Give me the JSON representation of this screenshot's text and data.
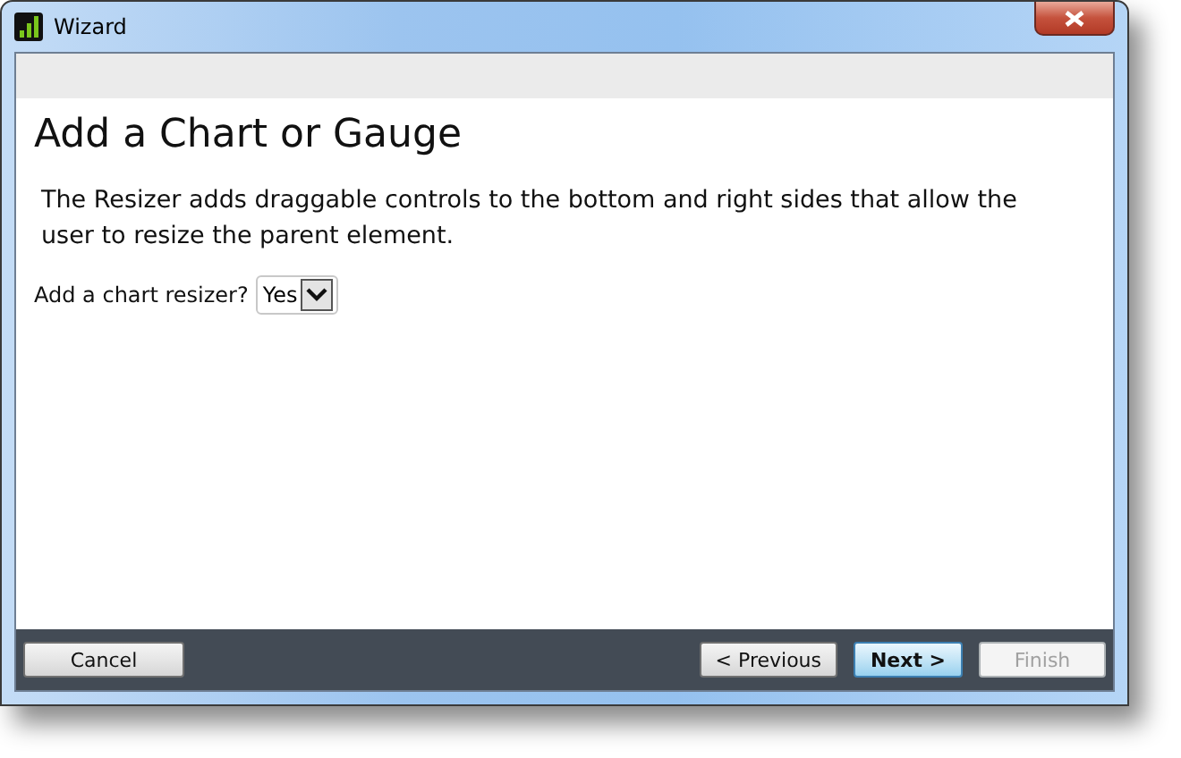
{
  "window": {
    "title": "Wizard"
  },
  "heading": "Add a Chart or Gauge",
  "description": "The Resizer adds draggable controls to the bottom and right sides that allow the user to resize the parent element.",
  "field": {
    "label": "Add a chart resizer?",
    "value": "Yes"
  },
  "footer": {
    "left_buttons": [
      {
        "label": "Cancel",
        "default": false,
        "disabled": false
      }
    ],
    "right_buttons": [
      {
        "label": "< Previous",
        "default": false,
        "disabled": false
      },
      {
        "label": "Next >",
        "default": true,
        "disabled": false
      },
      {
        "label": "Finish",
        "default": false,
        "disabled": true
      }
    ]
  }
}
